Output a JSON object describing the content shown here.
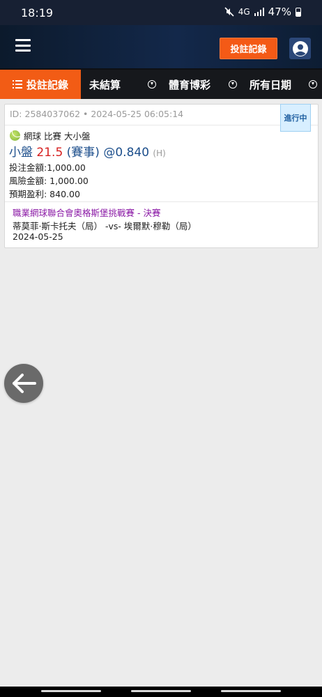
{
  "status_bar": {
    "time": "18:19",
    "network": "4G",
    "battery": "47%"
  },
  "header": {
    "bet_record_button": "投註記錄"
  },
  "tabs": [
    {
      "label": "投註記錄",
      "active": true
    },
    {
      "label": "未結算",
      "active": false
    },
    {
      "label": "體育博彩",
      "active": false
    },
    {
      "label": "所有日期",
      "active": false
    }
  ],
  "bet": {
    "id_text": "ID: 2584037062 • 2024-05-25 06:05:14",
    "status": "進行中",
    "sport_line": "網球 比賽 大小盤",
    "selection": "小盤",
    "handicap": "21.5",
    "period": "(賽事)",
    "odds": "@0.840",
    "odds_type": "(H)",
    "stake": "投注金額:1,000.00",
    "risk": "風險金額: 1,000.00",
    "expected_win": "預期盈利: 840.00",
    "league": "職業網球聯合會奧格斯堡挑戰賽 - 決賽",
    "match": "蒂莫菲·斯卡托夫（局） -vs- 埃爾默·穆勒（局）",
    "date": "2024-05-25"
  },
  "colors": {
    "accent_orange": "#f25c15",
    "header_navy": "#13284a",
    "selection_blue": "#1d4f8c",
    "handicap_red": "#d62020",
    "league_purple": "#8b1aa6"
  },
  "icons": [
    "menu-icon",
    "account-icon",
    "list-icon",
    "dropdown-icon",
    "tennis-ball-icon",
    "back-arrow-icon",
    "mute-icon",
    "signal-icon",
    "battery-icon"
  ]
}
